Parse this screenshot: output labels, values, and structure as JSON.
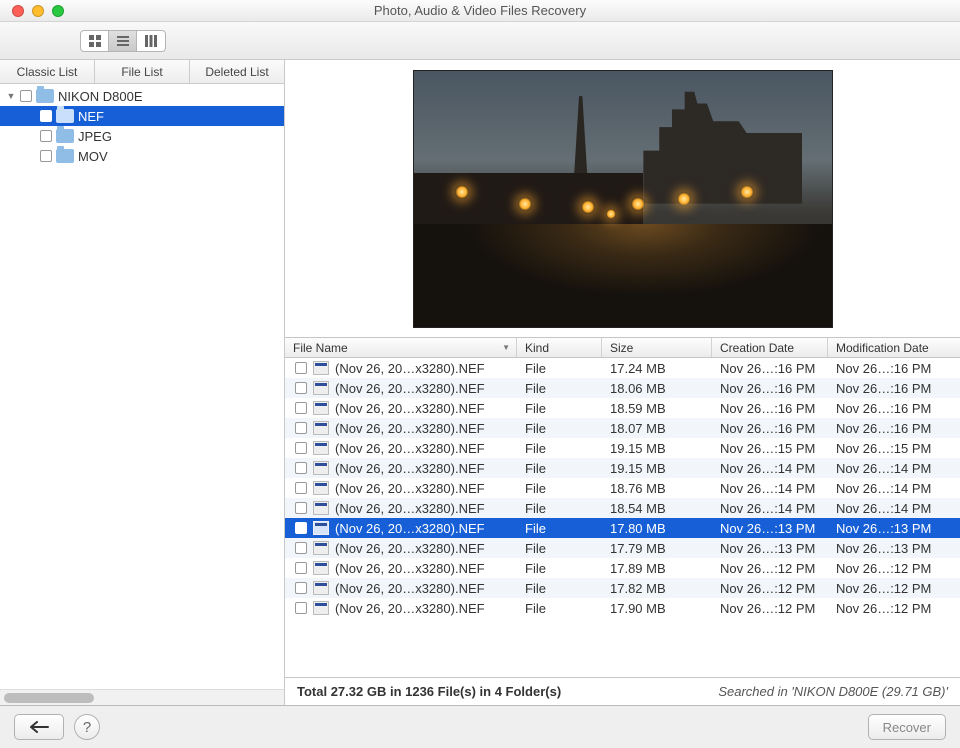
{
  "window": {
    "title": "Photo, Audio & Video Files Recovery"
  },
  "sidebar": {
    "tabs": [
      "Classic List",
      "File List",
      "Deleted List"
    ],
    "tree": {
      "root": "NIKON D800E",
      "children": [
        "NEF",
        "JPEG",
        "MOV"
      ],
      "selected": "NEF"
    }
  },
  "columns": {
    "name": "File Name",
    "kind": "Kind",
    "size": "Size",
    "cdate": "Creation Date",
    "mdate": "Modification Date"
  },
  "rows": [
    {
      "name": "(Nov 26, 20…x3280).NEF",
      "kind": "File",
      "size": "17.24 MB",
      "cdate": "Nov 26…:16 PM",
      "mdate": "Nov 26…:16 PM"
    },
    {
      "name": "(Nov 26, 20…x3280).NEF",
      "kind": "File",
      "size": "18.06 MB",
      "cdate": "Nov 26…:16 PM",
      "mdate": "Nov 26…:16 PM"
    },
    {
      "name": "(Nov 26, 20…x3280).NEF",
      "kind": "File",
      "size": "18.59 MB",
      "cdate": "Nov 26…:16 PM",
      "mdate": "Nov 26…:16 PM"
    },
    {
      "name": "(Nov 26, 20…x3280).NEF",
      "kind": "File",
      "size": "18.07 MB",
      "cdate": "Nov 26…:16 PM",
      "mdate": "Nov 26…:16 PM"
    },
    {
      "name": "(Nov 26, 20…x3280).NEF",
      "kind": "File",
      "size": "19.15 MB",
      "cdate": "Nov 26…:15 PM",
      "mdate": "Nov 26…:15 PM"
    },
    {
      "name": "(Nov 26, 20…x3280).NEF",
      "kind": "File",
      "size": "19.15 MB",
      "cdate": "Nov 26…:14 PM",
      "mdate": "Nov 26…:14 PM"
    },
    {
      "name": "(Nov 26, 20…x3280).NEF",
      "kind": "File",
      "size": "18.76 MB",
      "cdate": "Nov 26…:14 PM",
      "mdate": "Nov 26…:14 PM"
    },
    {
      "name": "(Nov 26, 20…x3280).NEF",
      "kind": "File",
      "size": "18.54 MB",
      "cdate": "Nov 26…:14 PM",
      "mdate": "Nov 26…:14 PM"
    },
    {
      "name": "(Nov 26, 20…x3280).NEF",
      "kind": "File",
      "size": "17.80 MB",
      "cdate": "Nov 26…:13 PM",
      "mdate": "Nov 26…:13 PM",
      "selected": true
    },
    {
      "name": "(Nov 26, 20…x3280).NEF",
      "kind": "File",
      "size": "17.79 MB",
      "cdate": "Nov 26…:13 PM",
      "mdate": "Nov 26…:13 PM"
    },
    {
      "name": "(Nov 26, 20…x3280).NEF",
      "kind": "File",
      "size": "17.89 MB",
      "cdate": "Nov 26…:12 PM",
      "mdate": "Nov 26…:12 PM"
    },
    {
      "name": "(Nov 26, 20…x3280).NEF",
      "kind": "File",
      "size": "17.82 MB",
      "cdate": "Nov 26…:12 PM",
      "mdate": "Nov 26…:12 PM"
    },
    {
      "name": "(Nov 26, 20…x3280).NEF",
      "kind": "File",
      "size": "17.90 MB",
      "cdate": "Nov 26…:12 PM",
      "mdate": "Nov 26…:12 PM"
    }
  ],
  "status": {
    "summary": "Total 27.32 GB in 1236 File(s) in 4 Folder(s)",
    "searched": "Searched in 'NIKON D800E (29.71 GB)'"
  },
  "buttons": {
    "back": "←",
    "help": "?",
    "recover": "Recover"
  }
}
